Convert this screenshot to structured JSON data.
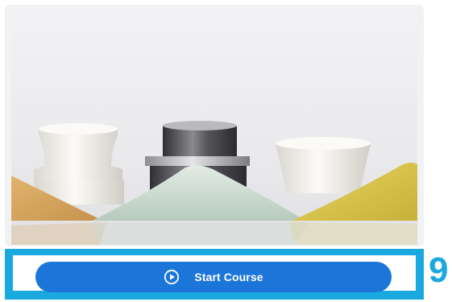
{
  "hero_image": {
    "icon": "course-thumbnail-image",
    "colors": {
      "background": "#ececef",
      "ceramic_white": "#f4f2ec",
      "metal_dark": "#4a4a4e",
      "powder_tan": "#d6a35d",
      "powder_mint": "#c8d8cd",
      "powder_yellow": "#d6c24a"
    }
  },
  "cta": {
    "label": "Start Course",
    "icon": "play-circle-icon",
    "colors": {
      "bar": "#1aa9df",
      "button": "#1c76d9",
      "text": "#ffffff"
    }
  },
  "badge": {
    "value": "9"
  }
}
